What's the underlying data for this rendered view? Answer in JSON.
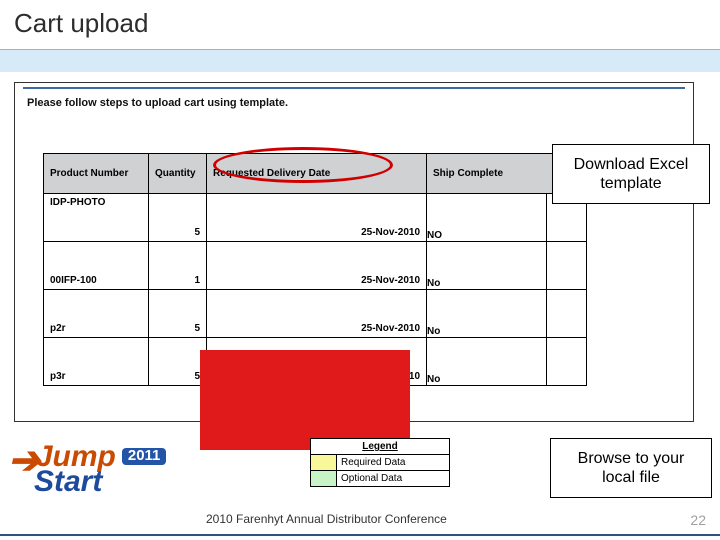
{
  "title": "Cart upload",
  "instruction": "Please follow steps to upload cart using template.",
  "table": {
    "headers": {
      "product_number": "Product Number",
      "quantity": "Quantity",
      "requested_date": "Requested Delivery Date",
      "ship_complete": "Ship Complete"
    },
    "rows": [
      {
        "pn": "IDP-PHOTO",
        "qty": "5",
        "date": "25-Nov-2010",
        "ship": "NO"
      },
      {
        "pn": "00IFP-100",
        "qty": "1",
        "date": "25-Nov-2010",
        "ship": "No"
      },
      {
        "pn": "p2r",
        "qty": "5",
        "date": "25-Nov-2010",
        "ship": "No"
      },
      {
        "pn": "p3r",
        "qty": "5",
        "date": "25-Nov-2010",
        "ship": "No"
      }
    ]
  },
  "callouts": {
    "download": "Download Excel template",
    "browse": "Browse to your local file"
  },
  "legend": {
    "title": "Legend",
    "required": "Required Data",
    "optional": "Optional Data"
  },
  "logo": {
    "word1": "Jump",
    "word2": "Start",
    "year": "2011"
  },
  "footer": "2010 Farenhyt Annual Distributor Conference",
  "page": "22"
}
